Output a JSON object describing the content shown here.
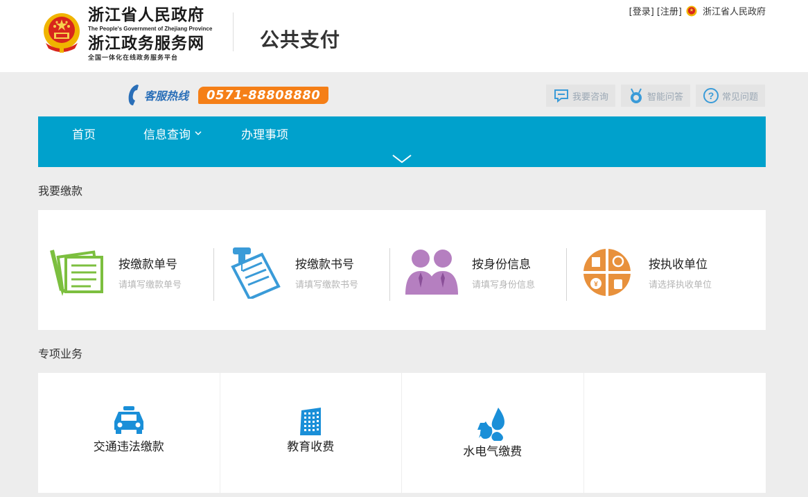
{
  "header": {
    "gov_name_cn": "浙江省人民政府",
    "gov_name_en": "The People's Government of Zhejiang Province",
    "portal_name": "浙江政务服务网",
    "slogan": "全国一体化在线政务服务平台",
    "site_title": "公共支付",
    "login_label": "[登录]",
    "register_label": "[注册]",
    "region_label": "浙江省人民政府"
  },
  "hotline": {
    "label": "客服热线",
    "number": "0571-88808880"
  },
  "help_links": [
    {
      "label": "我要咨询",
      "icon": "chat-icon"
    },
    {
      "label": "智能问答",
      "icon": "robot-icon"
    },
    {
      "label": "常见问题",
      "icon": "question-icon"
    }
  ],
  "nav": {
    "items": [
      "首页",
      "信息查询",
      "办理事项"
    ]
  },
  "payment": {
    "section_title": "我要缴款",
    "options": [
      {
        "title": "按缴款单号",
        "hint": "请填写缴款单号",
        "icon": "receipt-icon"
      },
      {
        "title": "按缴款书号",
        "hint": "请填写缴款书号",
        "icon": "pinned-document-icon"
      },
      {
        "title": "按身份信息",
        "hint": "请填写身份信息",
        "icon": "people-icon"
      },
      {
        "title": "按执收单位",
        "hint": "请选择执收单位",
        "icon": "agency-grid-icon"
      }
    ]
  },
  "special": {
    "section_title": "专项业务",
    "items": [
      {
        "label": "交通违法缴款",
        "icon": "taxi-icon"
      },
      {
        "label": "教育收费",
        "icon": "building-icon"
      },
      {
        "label": "水电气缴费",
        "icon": "utilities-icon"
      }
    ]
  },
  "colors": {
    "nav_bg": "#00a1cc",
    "hotline_orange": "#f57f17",
    "hotline_blue": "#2a6fb8",
    "icon_green": "#7cbf3f",
    "icon_blue": "#3a9bd8",
    "icon_purple": "#b57fc0",
    "icon_orange": "#e8913c",
    "biz_icon_blue": "#1a8fd8"
  }
}
